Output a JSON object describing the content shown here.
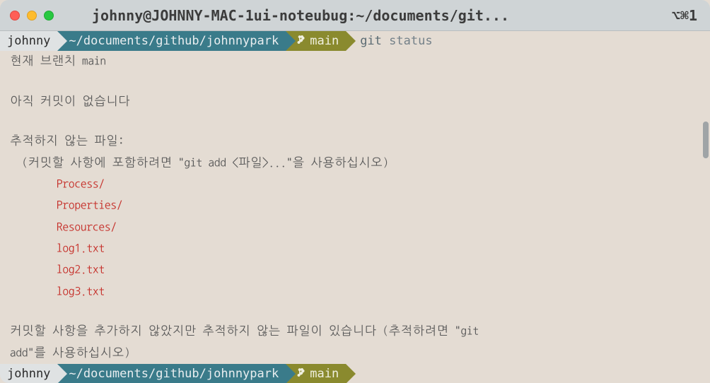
{
  "window": {
    "title": "johnny@JOHNNY-MAC-1ui-noteubug:~/documents/git...",
    "shortcut": "⌥⌘1"
  },
  "prompt1": {
    "user": "johnny",
    "path": "~/documents/github/johnnypark",
    "branch": "main",
    "command_git": "git",
    "command_args": "status"
  },
  "output": {
    "line1": "현재 브랜치 main",
    "line2": "아직 커밋이 없습니다",
    "line3": "추적하지 않는 파일:",
    "line4": "  (커밋할 사항에 포함하려면 \"git add <파일>...\"을 사용하십시오)",
    "untracked": [
      "Process/",
      "Properties/",
      "Resources/",
      "log1.txt",
      "log2.txt",
      "log3.txt"
    ],
    "line5a": "커밋할 사항을 추가하지 않았지만 추적하지 않는 파일이 있습니다 (추적하려면 \"git",
    "line5b": "add\"를 사용하십시오)"
  },
  "prompt2": {
    "user": "johnny",
    "path": "~/documents/github/johnnypark",
    "branch": "main"
  }
}
